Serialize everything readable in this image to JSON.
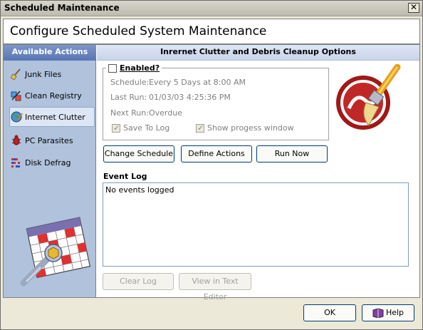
{
  "window": {
    "title": "Scheduled Maintenance",
    "close_glyph": "✕"
  },
  "header": {
    "title": "Configure Scheduled System Maintenance"
  },
  "sidebar": {
    "heading": "Available Actions",
    "items": [
      {
        "label": "Junk Files",
        "icon": "broom-icon"
      },
      {
        "label": "Clean Registry",
        "icon": "registry-icon"
      },
      {
        "label": "Internet Clutter",
        "icon": "globe-icon",
        "active": true
      },
      {
        "label": "PC Parasites",
        "icon": "bug-icon"
      },
      {
        "label": "Disk Defrag",
        "icon": "defrag-icon"
      }
    ]
  },
  "section": {
    "title": "Inrernet Clutter and Debris Cleanup Options",
    "enabled_label": "Enabled?",
    "enabled": false,
    "schedule_label": "Schedule:",
    "schedule_value": "Every 5 Days at 8:00 AM",
    "last_run_label": "Last Run:",
    "last_run_value": "01/03/03 4:25:36 PM",
    "next_run_label": "Next Run:",
    "next_run_value": "Overdue",
    "save_to_log_label": "Save To Log",
    "save_to_log": true,
    "show_progress_label": "Show progess window",
    "show_progress": true
  },
  "buttons": {
    "change_schedule": "Change Schedule",
    "define_actions": "Define Actions",
    "run_now": "Run Now",
    "clear_log": "Clear Log",
    "view_text_editor": "View in Text Editor",
    "ok": "OK",
    "help": "Help"
  },
  "event_log": {
    "label": "Event Log",
    "content": "No events logged"
  },
  "colors": {
    "sidebar_bg": "#b0c2dc",
    "header_bar": "#5a76b4",
    "logo_red": "#a01818"
  }
}
